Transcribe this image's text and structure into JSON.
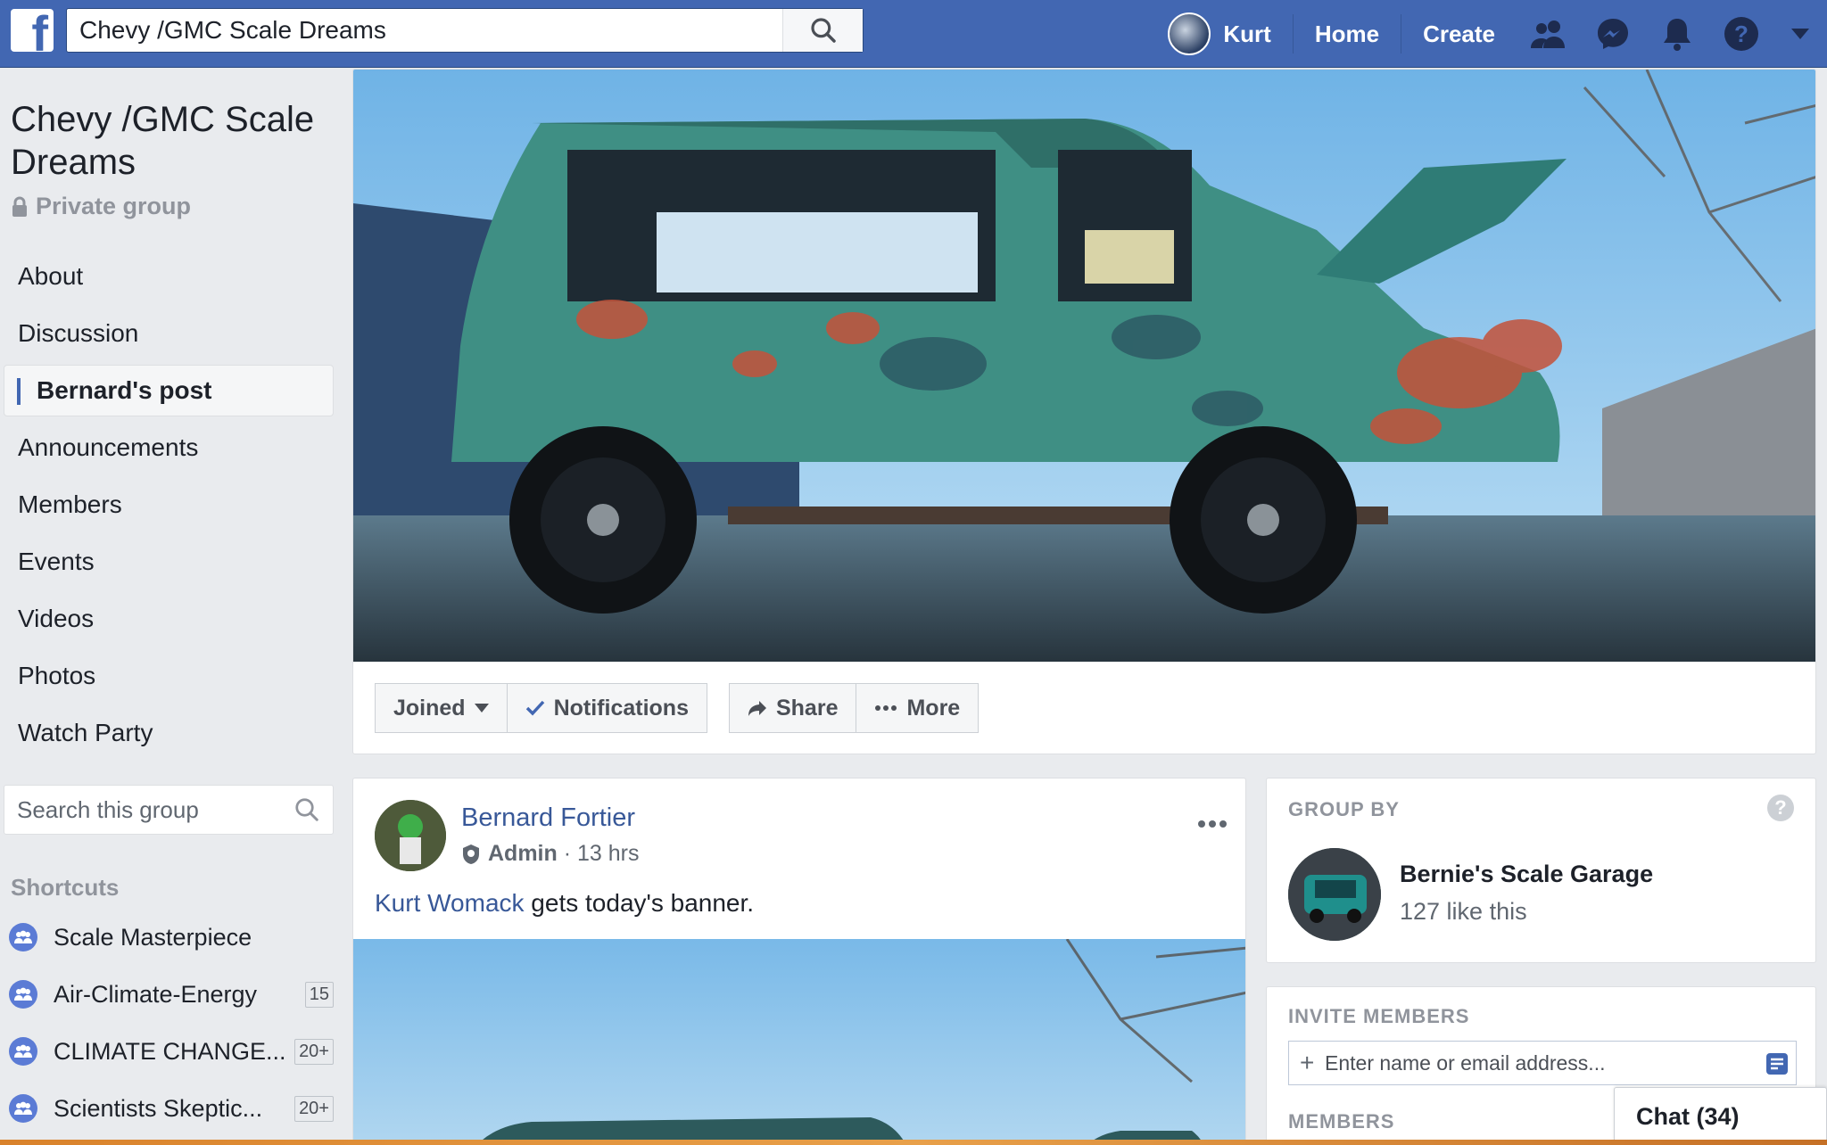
{
  "topbar": {
    "search_value": "Chevy /GMC Scale Dreams",
    "user_name": "Kurt",
    "home_label": "Home",
    "create_label": "Create",
    "icons": [
      "friends-icon",
      "messenger-icon",
      "notifications-icon",
      "help-icon",
      "menu-caret-icon"
    ]
  },
  "group": {
    "title": "Chevy /GMC Scale Dreams",
    "privacy": "Private group"
  },
  "sidebar": {
    "items": [
      {
        "label": "About"
      },
      {
        "label": "Discussion"
      },
      {
        "label": "Bernard's post",
        "active": true
      },
      {
        "label": "Announcements"
      },
      {
        "label": "Members"
      },
      {
        "label": "Events"
      },
      {
        "label": "Videos"
      },
      {
        "label": "Photos"
      },
      {
        "label": "Watch Party"
      }
    ],
    "search_placeholder": "Search this group",
    "shortcuts_heading": "Shortcuts",
    "shortcuts": [
      {
        "name": "Scale Masterpiece",
        "count": ""
      },
      {
        "name": "Air-Climate-Energy",
        "count": "15"
      },
      {
        "name": "CLIMATE CHANGE...",
        "count": "20+"
      },
      {
        "name": "Scientists Skeptic...",
        "count": "20+"
      }
    ]
  },
  "cover": {
    "actions": {
      "joined": "Joined",
      "notifications": "Notifications",
      "share": "Share",
      "more": "More"
    }
  },
  "post": {
    "author": "Bernard Fortier",
    "role": "Admin",
    "time": "13 hrs",
    "mention": "Kurt Womack",
    "text": " gets today's banner."
  },
  "group_by": {
    "heading": "GROUP BY",
    "page_name": "Bernie's Scale Garage",
    "likes": "127 like this"
  },
  "invite": {
    "heading": "INVITE MEMBERS",
    "placeholder": "Enter name or email address...",
    "members_heading": "MEMBERS"
  },
  "chat": {
    "label": "Chat (34)"
  },
  "colors": {
    "brand": "#4267b2",
    "link": "#385898",
    "background": "#e9ebee"
  }
}
